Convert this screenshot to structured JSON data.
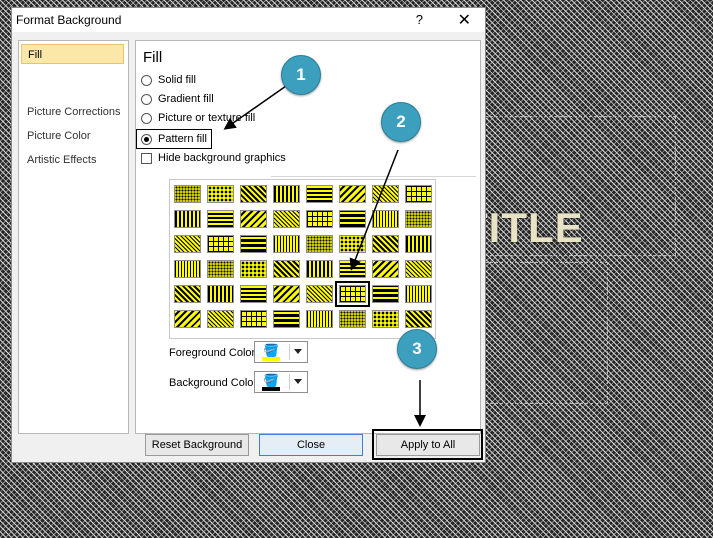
{
  "slide": {
    "title_text": "TITLE"
  },
  "dialog": {
    "title": "Format Background",
    "help_glyph": "?",
    "close_glyph": "✕"
  },
  "nav": {
    "items": [
      {
        "label": "Fill",
        "selected": true
      },
      {
        "label": "Picture Corrections",
        "selected": false
      },
      {
        "label": "Picture Color",
        "selected": false
      },
      {
        "label": "Artistic Effects",
        "selected": false
      }
    ]
  },
  "fill": {
    "heading": "Fill",
    "options": [
      {
        "label": "Solid fill",
        "checked": false
      },
      {
        "label": "Gradient fill",
        "checked": false
      },
      {
        "label": "Picture or texture fill",
        "checked": false
      },
      {
        "label": "Pattern fill",
        "checked": true
      }
    ],
    "hide_background": {
      "label": "Hide background graphics",
      "checked": false
    }
  },
  "pattern_grid": {
    "rows": 6,
    "cols": 8,
    "foreground": "#000000",
    "background": "#ffff00",
    "selected_row": 4,
    "selected_col": 5
  },
  "colors": {
    "foreground": {
      "label": "Foreground Color:",
      "value": "#ffff00",
      "icon": "paint-bucket-icon"
    },
    "background": {
      "label": "Background Color:",
      "value": "#000000",
      "icon": "paint-bucket-icon"
    }
  },
  "buttons": {
    "reset": "Reset Background",
    "close": "Close",
    "apply_all": "Apply to All"
  },
  "annotations": [
    {
      "number": "1",
      "color": "#3c9fbd"
    },
    {
      "number": "2",
      "color": "#3c9fbd"
    },
    {
      "number": "3",
      "color": "#3c9fbd"
    }
  ]
}
